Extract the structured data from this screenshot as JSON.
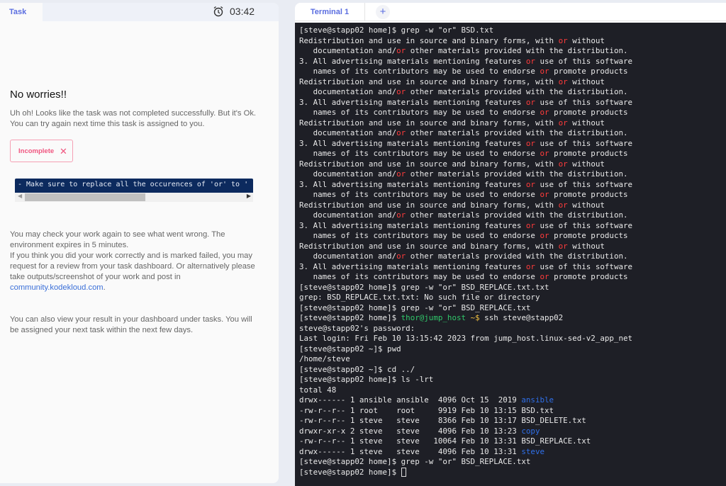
{
  "task_panel": {
    "tab_label": "Task",
    "timer": "03:42",
    "title": "No worries!!",
    "message": "Uh oh! Looks like the task was not completed successfully. But it's Ok. You can try again next time this task is assigned to you.",
    "status_badge": "Incomplete",
    "status_close": "✕",
    "code_snippet": "- Make sure to replace all the occurences of 'or' to '",
    "info_1": "You may check your work again to see what went wrong. The environment expires in 5 minutes.",
    "info_2": "If you think you did your work correctly and is marked failed, you may request for a review from your task dashboard. Or alternatively please take outputs/screenshot of your work and post in ",
    "community_link": "community.kodekloud.com",
    "info_2_end": ".",
    "info_3": "You can also view your result in your dashboard under tasks. You will be assigned your next task within the next few days."
  },
  "terminal_panel": {
    "tab_label": "Terminal 1",
    "add_tab": "+",
    "colors": {
      "highlight": "#ff3b3b",
      "prompt_user": "#30c76a",
      "directory": "#2f6fe8"
    },
    "lines": [
      [
        {
          "t": "[steve@stapp02 home]$ grep -w \"or\" BSD.txt"
        }
      ],
      [
        {
          "t": "Redistribution and use in source and binary forms, with "
        },
        {
          "t": "or",
          "c": "red"
        },
        {
          "t": " without"
        }
      ],
      [
        {
          "t": "   documentation and/"
        },
        {
          "t": "or",
          "c": "red"
        },
        {
          "t": " other materials provided with the distribution."
        }
      ],
      [
        {
          "t": "3. All advertising materials mentioning features "
        },
        {
          "t": "or",
          "c": "red"
        },
        {
          "t": " use of this software"
        }
      ],
      [
        {
          "t": "   names of its contributors may be used to endorse "
        },
        {
          "t": "or",
          "c": "red"
        },
        {
          "t": " promote products"
        }
      ],
      [
        {
          "t": "Redistribution and use in source and binary forms, with "
        },
        {
          "t": "or",
          "c": "red"
        },
        {
          "t": " without"
        }
      ],
      [
        {
          "t": "   documentation and/"
        },
        {
          "t": "or",
          "c": "red"
        },
        {
          "t": " other materials provided with the distribution."
        }
      ],
      [
        {
          "t": "3. All advertising materials mentioning features "
        },
        {
          "t": "or",
          "c": "red"
        },
        {
          "t": " use of this software"
        }
      ],
      [
        {
          "t": "   names of its contributors may be used to endorse "
        },
        {
          "t": "or",
          "c": "red"
        },
        {
          "t": " promote products"
        }
      ],
      [
        {
          "t": "Redistribution and use in source and binary forms, with "
        },
        {
          "t": "or",
          "c": "red"
        },
        {
          "t": " without"
        }
      ],
      [
        {
          "t": "   documentation and/"
        },
        {
          "t": "or",
          "c": "red"
        },
        {
          "t": " other materials provided with the distribution."
        }
      ],
      [
        {
          "t": "3. All advertising materials mentioning features "
        },
        {
          "t": "or",
          "c": "red"
        },
        {
          "t": " use of this software"
        }
      ],
      [
        {
          "t": "   names of its contributors may be used to endorse "
        },
        {
          "t": "or",
          "c": "red"
        },
        {
          "t": " promote products"
        }
      ],
      [
        {
          "t": "Redistribution and use in source and binary forms, with "
        },
        {
          "t": "or",
          "c": "red"
        },
        {
          "t": " without"
        }
      ],
      [
        {
          "t": "   documentation and/"
        },
        {
          "t": "or",
          "c": "red"
        },
        {
          "t": " other materials provided with the distribution."
        }
      ],
      [
        {
          "t": "3. All advertising materials mentioning features "
        },
        {
          "t": "or",
          "c": "red"
        },
        {
          "t": " use of this software"
        }
      ],
      [
        {
          "t": "   names of its contributors may be used to endorse "
        },
        {
          "t": "or",
          "c": "red"
        },
        {
          "t": " promote products"
        }
      ],
      [
        {
          "t": "Redistribution and use in source and binary forms, with "
        },
        {
          "t": "or",
          "c": "red"
        },
        {
          "t": " without"
        }
      ],
      [
        {
          "t": "   documentation and/"
        },
        {
          "t": "or",
          "c": "red"
        },
        {
          "t": " other materials provided with the distribution."
        }
      ],
      [
        {
          "t": "3. All advertising materials mentioning features "
        },
        {
          "t": "or",
          "c": "red"
        },
        {
          "t": " use of this software"
        }
      ],
      [
        {
          "t": "   names of its contributors may be used to endorse "
        },
        {
          "t": "or",
          "c": "red"
        },
        {
          "t": " promote products"
        }
      ],
      [
        {
          "t": "Redistribution and use in source and binary forms, with "
        },
        {
          "t": "or",
          "c": "red"
        },
        {
          "t": " without"
        }
      ],
      [
        {
          "t": "   documentation and/"
        },
        {
          "t": "or",
          "c": "red"
        },
        {
          "t": " other materials provided with the distribution."
        }
      ],
      [
        {
          "t": "3. All advertising materials mentioning features "
        },
        {
          "t": "or",
          "c": "red"
        },
        {
          "t": " use of this software"
        }
      ],
      [
        {
          "t": "   names of its contributors may be used to endorse "
        },
        {
          "t": "or",
          "c": "red"
        },
        {
          "t": " promote products"
        }
      ],
      [
        {
          "t": "[steve@stapp02 home]$ grep -w \"or\" BSD_REPLACE.txt.txt"
        }
      ],
      [
        {
          "t": "grep: BSD_REPLACE.txt.txt: No such file or directory"
        }
      ],
      [
        {
          "t": "[steve@stapp02 home]$ grep -w \"or\" BSD_REPLACE.txt"
        }
      ],
      [
        {
          "t": "[steve@stapp02 home]$ "
        },
        {
          "t": "thor@jump_host",
          "c": "green"
        },
        {
          "t": " ~$",
          "c": "yellow"
        },
        {
          "t": " ssh steve@stapp02"
        }
      ],
      [
        {
          "t": "steve@stapp02's password:"
        }
      ],
      [
        {
          "t": "Last login: Fri Feb 10 13:15:42 2023 from jump_host.linux-sed-v2_app_net"
        }
      ],
      [
        {
          "t": "[steve@stapp02 ~]$ pwd"
        }
      ],
      [
        {
          "t": "/home/steve"
        }
      ],
      [
        {
          "t": "[steve@stapp02 ~]$ cd ../"
        }
      ],
      [
        {
          "t": "[steve@stapp02 home]$ ls -lrt"
        }
      ],
      [
        {
          "t": "total 48"
        }
      ],
      [
        {
          "t": "drwx------ 1 ansible ansible  4096 Oct 15  2019 "
        },
        {
          "t": "ansible",
          "c": "blue"
        }
      ],
      [
        {
          "t": "-rw-r--r-- 1 root    root     9919 Feb 10 13:15 BSD.txt"
        }
      ],
      [
        {
          "t": "-rw-r--r-- 1 steve   steve    8366 Feb 10 13:17 BSD_DELETE.txt"
        }
      ],
      [
        {
          "t": "drwxr-xr-x 2 steve   steve    4096 Feb 10 13:23 "
        },
        {
          "t": "copy",
          "c": "blue"
        }
      ],
      [
        {
          "t": "-rw-r--r-- 1 steve   steve   10064 Feb 10 13:31 BSD_REPLACE.txt"
        }
      ],
      [
        {
          "t": "drwx------ 1 steve   steve    4096 Feb 10 13:31 "
        },
        {
          "t": "steve",
          "c": "blue"
        }
      ],
      [
        {
          "t": "[steve@stapp02 home]$ grep -w \"or\" BSD_REPLACE.txt"
        }
      ],
      [
        {
          "t": "[steve@stapp02 home]$ "
        },
        {
          "cursor": true
        }
      ]
    ]
  }
}
